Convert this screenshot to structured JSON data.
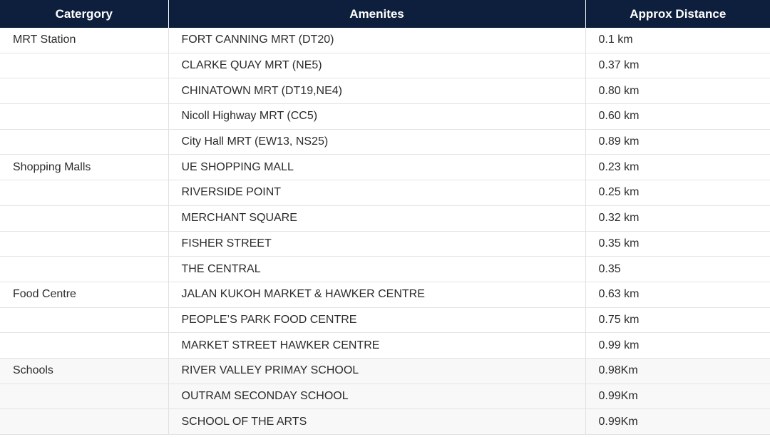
{
  "table": {
    "headers": [
      "Catergory",
      "Amenites",
      "Approx Distance"
    ],
    "rows": [
      {
        "category": "MRT Station",
        "amenity": "FORT CANNING MRT (DT20)",
        "distance": "0.1 km"
      },
      {
        "category": "",
        "amenity": "CLARKE QUAY MRT (NE5)",
        "distance": "0.37 km"
      },
      {
        "category": "",
        "amenity": "CHINATOWN MRT (DT19,NE4)",
        "distance": "0.80 km"
      },
      {
        "category": "",
        "amenity": "Nicoll Highway MRT (CC5)",
        "distance": "0.60 km"
      },
      {
        "category": "",
        "amenity": "City Hall MRT (EW13, NS25)",
        "distance": "0.89 km"
      },
      {
        "category": "Shopping Malls",
        "amenity": "UE SHOPPING MALL",
        "distance": "0.23 km"
      },
      {
        "category": "",
        "amenity": "RIVERSIDE POINT",
        "distance": "0.25 km"
      },
      {
        "category": "",
        "amenity": "MERCHANT SQUARE",
        "distance": "0.32 km"
      },
      {
        "category": "",
        "amenity": "FISHER STREET",
        "distance": "0.35 km"
      },
      {
        "category": "",
        "amenity": "THE CENTRAL",
        "distance": "0.35"
      },
      {
        "category": "Food Centre",
        "amenity": "JALAN KUKOH MARKET & HAWKER CENTRE",
        "distance": "0.63 km"
      },
      {
        "category": "",
        "amenity": "PEOPLE’S PARK FOOD CENTRE",
        "distance": "0.75 km"
      },
      {
        "category": "",
        "amenity": "MARKET STREET HAWKER CENTRE",
        "distance": "0.99 km"
      },
      {
        "category": "Schools",
        "amenity": "RIVER VALLEY PRIMAY SCHOOL",
        "distance": "0.98Km"
      },
      {
        "category": "",
        "amenity": "OUTRAM SECONDAY SCHOOL",
        "distance": "0.99Km"
      },
      {
        "category": "",
        "amenity": "SCHOOL OF THE ARTS",
        "distance": "0.99Km"
      }
    ]
  }
}
